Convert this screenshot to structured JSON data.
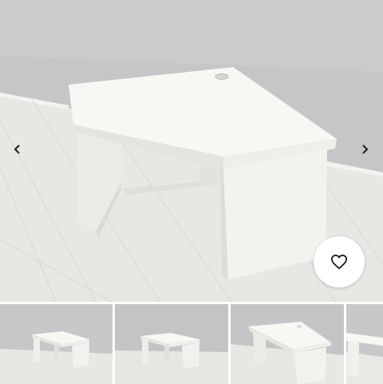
{
  "gallery": {
    "prev_icon": "chevron-left-icon",
    "next_icon": "chevron-right-icon",
    "favorite_icon": "heart-outline-icon",
    "thumbnail_count": 4,
    "colors": {
      "wall": "#c4c4c6",
      "floor": "#e8e6e3",
      "desk": "#f7f6f2",
      "arrow": "#1c1c1c",
      "favorite_button_bg": "#ffffff"
    }
  }
}
